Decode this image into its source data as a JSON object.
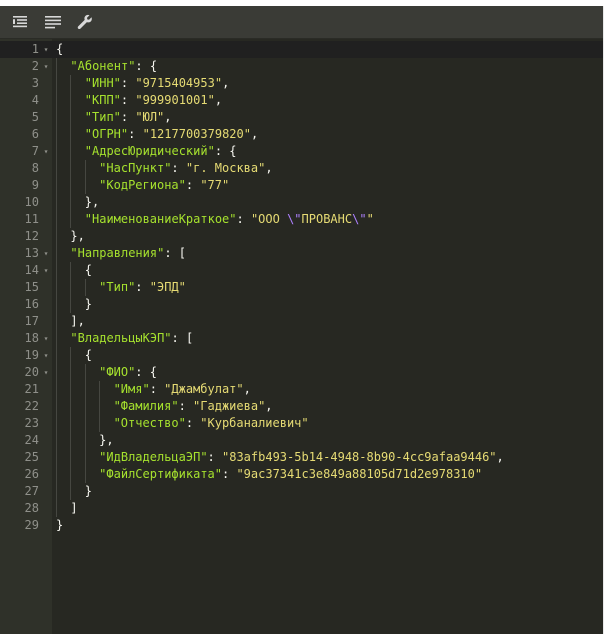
{
  "toolbar": {
    "buttons": [
      {
        "name": "format-code-icon"
      },
      {
        "name": "compact-code-icon"
      },
      {
        "name": "repair-wrench-icon"
      }
    ]
  },
  "editor": {
    "lines": [
      {
        "n": "1",
        "fold": "▾",
        "tokens": [
          {
            "t": "p",
            "v": "{"
          }
        ]
      },
      {
        "n": "2",
        "fold": "▾",
        "indent": 1,
        "tokens": [
          {
            "t": "k",
            "v": "\"Абонент\""
          },
          {
            "t": "p",
            "v": ": {"
          }
        ]
      },
      {
        "n": "3",
        "indent": 2,
        "tokens": [
          {
            "t": "k",
            "v": "\"ИНН\""
          },
          {
            "t": "p",
            "v": ": "
          },
          {
            "t": "s",
            "v": "\"9715404953\""
          },
          {
            "t": "p",
            "v": ","
          }
        ]
      },
      {
        "n": "4",
        "indent": 2,
        "tokens": [
          {
            "t": "k",
            "v": "\"КПП\""
          },
          {
            "t": "p",
            "v": ": "
          },
          {
            "t": "s",
            "v": "\"999901001\""
          },
          {
            "t": "p",
            "v": ","
          }
        ]
      },
      {
        "n": "5",
        "indent": 2,
        "tokens": [
          {
            "t": "k",
            "v": "\"Тип\""
          },
          {
            "t": "p",
            "v": ": "
          },
          {
            "t": "s",
            "v": "\"ЮЛ\""
          },
          {
            "t": "p",
            "v": ","
          }
        ]
      },
      {
        "n": "6",
        "indent": 2,
        "tokens": [
          {
            "t": "k",
            "v": "\"ОГРН\""
          },
          {
            "t": "p",
            "v": ": "
          },
          {
            "t": "s",
            "v": "\"1217700379820\""
          },
          {
            "t": "p",
            "v": ","
          }
        ]
      },
      {
        "n": "7",
        "fold": "▾",
        "indent": 2,
        "tokens": [
          {
            "t": "k",
            "v": "\"АдресЮридический\""
          },
          {
            "t": "p",
            "v": ": {"
          }
        ]
      },
      {
        "n": "8",
        "indent": 3,
        "tokens": [
          {
            "t": "k",
            "v": "\"НасПункт\""
          },
          {
            "t": "p",
            "v": ": "
          },
          {
            "t": "s",
            "v": "\"г. Москва\""
          },
          {
            "t": "p",
            "v": ","
          }
        ]
      },
      {
        "n": "9",
        "indent": 3,
        "tokens": [
          {
            "t": "k",
            "v": "\"КодРегиона\""
          },
          {
            "t": "p",
            "v": ": "
          },
          {
            "t": "s",
            "v": "\"77\""
          }
        ]
      },
      {
        "n": "10",
        "indent": 2,
        "tokens": [
          {
            "t": "p",
            "v": "},"
          }
        ]
      },
      {
        "n": "11",
        "indent": 2,
        "tokens": [
          {
            "t": "k",
            "v": "\"НаименованиеКраткое\""
          },
          {
            "t": "p",
            "v": ": "
          },
          {
            "t": "s",
            "v": "\"ООО "
          },
          {
            "t": "e",
            "v": "\\\""
          },
          {
            "t": "s",
            "v": "ПРОВАНС"
          },
          {
            "t": "e",
            "v": "\\\""
          },
          {
            "t": "s",
            "v": "\""
          }
        ]
      },
      {
        "n": "12",
        "indent": 1,
        "tokens": [
          {
            "t": "p",
            "v": "},"
          }
        ]
      },
      {
        "n": "13",
        "fold": "▾",
        "indent": 1,
        "tokens": [
          {
            "t": "k",
            "v": "\"Направления\""
          },
          {
            "t": "p",
            "v": ": ["
          }
        ]
      },
      {
        "n": "14",
        "fold": "▾",
        "indent": 2,
        "tokens": [
          {
            "t": "p",
            "v": "{"
          }
        ]
      },
      {
        "n": "15",
        "indent": 3,
        "tokens": [
          {
            "t": "k",
            "v": "\"Тип\""
          },
          {
            "t": "p",
            "v": ": "
          },
          {
            "t": "s",
            "v": "\"ЭПД\""
          }
        ]
      },
      {
        "n": "16",
        "indent": 2,
        "tokens": [
          {
            "t": "p",
            "v": "}"
          }
        ]
      },
      {
        "n": "17",
        "indent": 1,
        "tokens": [
          {
            "t": "p",
            "v": "],"
          }
        ]
      },
      {
        "n": "18",
        "fold": "▾",
        "indent": 1,
        "tokens": [
          {
            "t": "k",
            "v": "\"ВладельцыКЭП\""
          },
          {
            "t": "p",
            "v": ": ["
          }
        ]
      },
      {
        "n": "19",
        "fold": "▾",
        "indent": 2,
        "tokens": [
          {
            "t": "p",
            "v": "{"
          }
        ]
      },
      {
        "n": "20",
        "fold": "▾",
        "indent": 3,
        "tokens": [
          {
            "t": "k",
            "v": "\"ФИО\""
          },
          {
            "t": "p",
            "v": ": {"
          }
        ]
      },
      {
        "n": "21",
        "indent": 4,
        "tokens": [
          {
            "t": "k",
            "v": "\"Имя\""
          },
          {
            "t": "p",
            "v": ": "
          },
          {
            "t": "s",
            "v": "\"Джамбулат\""
          },
          {
            "t": "p",
            "v": ","
          }
        ]
      },
      {
        "n": "22",
        "indent": 4,
        "tokens": [
          {
            "t": "k",
            "v": "\"Фамилия\""
          },
          {
            "t": "p",
            "v": ": "
          },
          {
            "t": "s",
            "v": "\"Гаджиева\""
          },
          {
            "t": "p",
            "v": ","
          }
        ]
      },
      {
        "n": "23",
        "indent": 4,
        "tokens": [
          {
            "t": "k",
            "v": "\"Отчество\""
          },
          {
            "t": "p",
            "v": ": "
          },
          {
            "t": "s",
            "v": "\"Курбаналиевич\""
          }
        ]
      },
      {
        "n": "24",
        "indent": 3,
        "tokens": [
          {
            "t": "p",
            "v": "},"
          }
        ]
      },
      {
        "n": "25",
        "indent": 3,
        "tokens": [
          {
            "t": "k",
            "v": "\"ИдВладельцаЭП\""
          },
          {
            "t": "p",
            "v": ": "
          },
          {
            "t": "s",
            "v": "\"83afb493-5b14-4948-8b90-4cc9afaa9446\""
          },
          {
            "t": "p",
            "v": ","
          }
        ]
      },
      {
        "n": "26",
        "indent": 3,
        "tokens": [
          {
            "t": "k",
            "v": "\"ФайлСертификата\""
          },
          {
            "t": "p",
            "v": ": "
          },
          {
            "t": "s",
            "v": "\"9ac37341c3e849a88105d71d2e978310\""
          }
        ]
      },
      {
        "n": "27",
        "indent": 2,
        "tokens": [
          {
            "t": "p",
            "v": "}"
          }
        ]
      },
      {
        "n": "28",
        "indent": 1,
        "tokens": [
          {
            "t": "p",
            "v": "]"
          }
        ]
      },
      {
        "n": "29",
        "tokens": [
          {
            "t": "p",
            "v": "}"
          }
        ]
      }
    ]
  },
  "colors": {
    "background": "#272822",
    "gutter": "#2f3129",
    "key": "#a6e22e",
    "string": "#e6db74",
    "escape": "#ae81ff",
    "punctuation": "#f8f8f2",
    "line_number": "#8f908a"
  }
}
